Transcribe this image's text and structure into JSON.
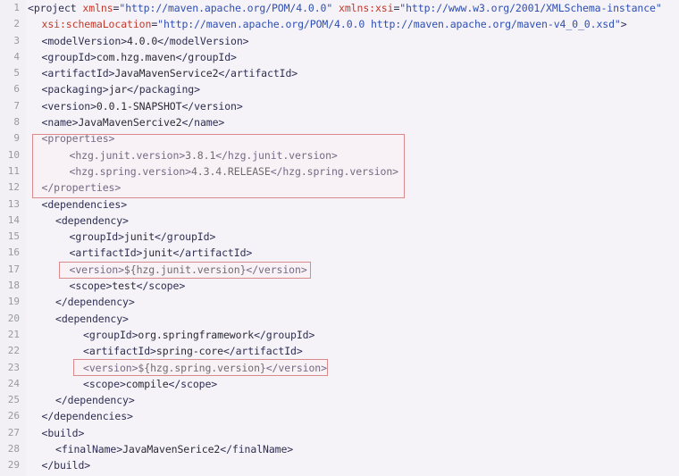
{
  "editor": {
    "language": "xml",
    "filename_hint": "pom.xml",
    "total_lines": 29,
    "background_color": "#f5f3f8",
    "gutter_color": "#f2f0f5",
    "line_number_color": "#999a9e",
    "tag_color": "#2e2e52",
    "attribute_color": "#c0392b",
    "attribute_value_color": "#2f4fb0",
    "text_color": "#2b2b35",
    "highlight_border_color": "#d98a8a",
    "highlight_fill_color": "#ffebee"
  },
  "line_numbers": [
    "1",
    "2",
    "3",
    "4",
    "5",
    "6",
    "7",
    "8",
    "9",
    "10",
    "11",
    "12",
    "13",
    "14",
    "15",
    "16",
    "17",
    "18",
    "19",
    "20",
    "21",
    "22",
    "23",
    "24",
    "25",
    "26",
    "27",
    "28",
    "29"
  ],
  "lines": [
    {
      "number": "1",
      "indent": 0,
      "tokens": [
        {
          "type": "tag",
          "text": "<project "
        },
        {
          "type": "attr",
          "text": "xmlns"
        },
        {
          "type": "punc",
          "text": "="
        },
        {
          "type": "attrval",
          "text": "\"http://maven.apache.org/POM/4.0.0\""
        },
        {
          "type": "tag",
          "text": " "
        },
        {
          "type": "attr",
          "text": "xmlns:xsi"
        },
        {
          "type": "punc",
          "text": "="
        },
        {
          "type": "attrval",
          "text": "\"http://www.w3.org/2001/XMLSchema-instance\""
        }
      ]
    },
    {
      "number": "2",
      "indent": 1,
      "tokens": [
        {
          "type": "attr",
          "text": "xsi:schemaLocation"
        },
        {
          "type": "punc",
          "text": "="
        },
        {
          "type": "attrval",
          "text": "\"http://maven.apache.org/POM/4.0.0 http://maven.apache.org/maven-v4_0_0.xsd\""
        },
        {
          "type": "tag",
          "text": ">"
        }
      ]
    },
    {
      "number": "3",
      "indent": 1,
      "tokens": [
        {
          "type": "tag",
          "text": "<modelVersion>"
        },
        {
          "type": "txt",
          "text": "4.0.0"
        },
        {
          "type": "tag",
          "text": "</modelVersion>"
        }
      ]
    },
    {
      "number": "4",
      "indent": 1,
      "tokens": [
        {
          "type": "tag",
          "text": "<groupId>"
        },
        {
          "type": "txt",
          "text": "com.hzg.maven"
        },
        {
          "type": "tag",
          "text": "</groupId>"
        }
      ]
    },
    {
      "number": "5",
      "indent": 1,
      "tokens": [
        {
          "type": "tag",
          "text": "<artifactId>"
        },
        {
          "type": "txt",
          "text": "JavaMavenService2"
        },
        {
          "type": "tag",
          "text": "</artifactId>"
        }
      ]
    },
    {
      "number": "6",
      "indent": 1,
      "tokens": [
        {
          "type": "tag",
          "text": "<packaging>"
        },
        {
          "type": "txt",
          "text": "jar"
        },
        {
          "type": "tag",
          "text": "</packaging>"
        }
      ]
    },
    {
      "number": "7",
      "indent": 1,
      "tokens": [
        {
          "type": "tag",
          "text": "<version>"
        },
        {
          "type": "txt",
          "text": "0.0.1-SNAPSHOT"
        },
        {
          "type": "tag",
          "text": "</version>"
        }
      ]
    },
    {
      "number": "8",
      "indent": 1,
      "tokens": [
        {
          "type": "tag",
          "text": "<name>"
        },
        {
          "type": "txt",
          "text": "JavaMavenSercive2"
        },
        {
          "type": "tag",
          "text": "</name>"
        }
      ]
    },
    {
      "number": "9",
      "indent": 1,
      "tokens": [
        {
          "type": "tag",
          "text": "<properties>"
        }
      ]
    },
    {
      "number": "10",
      "indent": 3,
      "tokens": [
        {
          "type": "tag",
          "text": "<hzg.junit.version>"
        },
        {
          "type": "txt",
          "text": "3.8.1"
        },
        {
          "type": "tag",
          "text": "</hzg.junit.version>"
        }
      ]
    },
    {
      "number": "11",
      "indent": 3,
      "tokens": [
        {
          "type": "tag",
          "text": "<hzg.spring.version>"
        },
        {
          "type": "txt",
          "text": "4.3.4.RELEASE"
        },
        {
          "type": "tag",
          "text": "</hzg.spring.version>"
        }
      ]
    },
    {
      "number": "12",
      "indent": 1,
      "tokens": [
        {
          "type": "tag",
          "text": "</properties>"
        }
      ]
    },
    {
      "number": "13",
      "indent": 1,
      "tokens": [
        {
          "type": "tag",
          "text": "<dependencies>"
        }
      ]
    },
    {
      "number": "14",
      "indent": 2,
      "tokens": [
        {
          "type": "tag",
          "text": "<dependency>"
        }
      ]
    },
    {
      "number": "15",
      "indent": 3,
      "tokens": [
        {
          "type": "tag",
          "text": "<groupId>"
        },
        {
          "type": "txt",
          "text": "junit"
        },
        {
          "type": "tag",
          "text": "</groupId>"
        }
      ]
    },
    {
      "number": "16",
      "indent": 3,
      "tokens": [
        {
          "type": "tag",
          "text": "<artifactId>"
        },
        {
          "type": "txt",
          "text": "junit"
        },
        {
          "type": "tag",
          "text": "</artifactId>"
        }
      ]
    },
    {
      "number": "17",
      "indent": 3,
      "tokens": [
        {
          "type": "tag",
          "text": "<version>"
        },
        {
          "type": "txt",
          "text": "${hzg.junit.version}"
        },
        {
          "type": "tag",
          "text": "</version>"
        }
      ]
    },
    {
      "number": "18",
      "indent": 3,
      "tokens": [
        {
          "type": "tag",
          "text": "<scope>"
        },
        {
          "type": "txt",
          "text": "test"
        },
        {
          "type": "tag",
          "text": "</scope>"
        }
      ]
    },
    {
      "number": "19",
      "indent": 2,
      "tokens": [
        {
          "type": "tag",
          "text": "</dependency>"
        }
      ]
    },
    {
      "number": "20",
      "indent": 2,
      "tokens": [
        {
          "type": "tag",
          "text": "<dependency>"
        }
      ]
    },
    {
      "number": "21",
      "indent": 4,
      "tokens": [
        {
          "type": "tag",
          "text": "<groupId>"
        },
        {
          "type": "txt",
          "text": "org.springframework"
        },
        {
          "type": "tag",
          "text": "</groupId>"
        }
      ]
    },
    {
      "number": "22",
      "indent": 4,
      "tokens": [
        {
          "type": "tag",
          "text": "<artifactId>"
        },
        {
          "type": "txt",
          "text": "spring-core"
        },
        {
          "type": "tag",
          "text": "</artifactId>"
        }
      ]
    },
    {
      "number": "23",
      "indent": 4,
      "tokens": [
        {
          "type": "tag",
          "text": "<version>"
        },
        {
          "type": "txt",
          "text": "${hzg.spring.version}"
        },
        {
          "type": "tag",
          "text": "</version>"
        }
      ]
    },
    {
      "number": "24",
      "indent": 4,
      "tokens": [
        {
          "type": "tag",
          "text": "<scope>"
        },
        {
          "type": "txt",
          "text": "compile"
        },
        {
          "type": "tag",
          "text": "</scope>"
        }
      ]
    },
    {
      "number": "25",
      "indent": 2,
      "tokens": [
        {
          "type": "tag",
          "text": "</dependency>"
        }
      ]
    },
    {
      "number": "26",
      "indent": 1,
      "tokens": [
        {
          "type": "tag",
          "text": "</dependencies>"
        }
      ]
    },
    {
      "number": "27",
      "indent": 1,
      "tokens": [
        {
          "type": "tag",
          "text": "<build>"
        }
      ]
    },
    {
      "number": "28",
      "indent": 2,
      "tokens": [
        {
          "type": "tag",
          "text": "<finalName>"
        },
        {
          "type": "txt",
          "text": "JavaMavenSerice2"
        },
        {
          "type": "tag",
          "text": "</finalName>"
        }
      ]
    },
    {
      "number": "29",
      "indent": 1,
      "tokens": [
        {
          "type": "tag",
          "text": "</build>"
        }
      ]
    }
  ],
  "annotations": [
    {
      "id": "hl-properties",
      "label": "properties-block-highlight",
      "covers_lines": [
        "9",
        "10",
        "11",
        "12"
      ]
    },
    {
      "id": "hl-junit-version",
      "label": "junit-version-property-reference-highlight",
      "covers_lines": [
        "17"
      ]
    },
    {
      "id": "hl-spring-version",
      "label": "spring-version-property-reference-highlight",
      "covers_lines": [
        "23"
      ]
    }
  ]
}
